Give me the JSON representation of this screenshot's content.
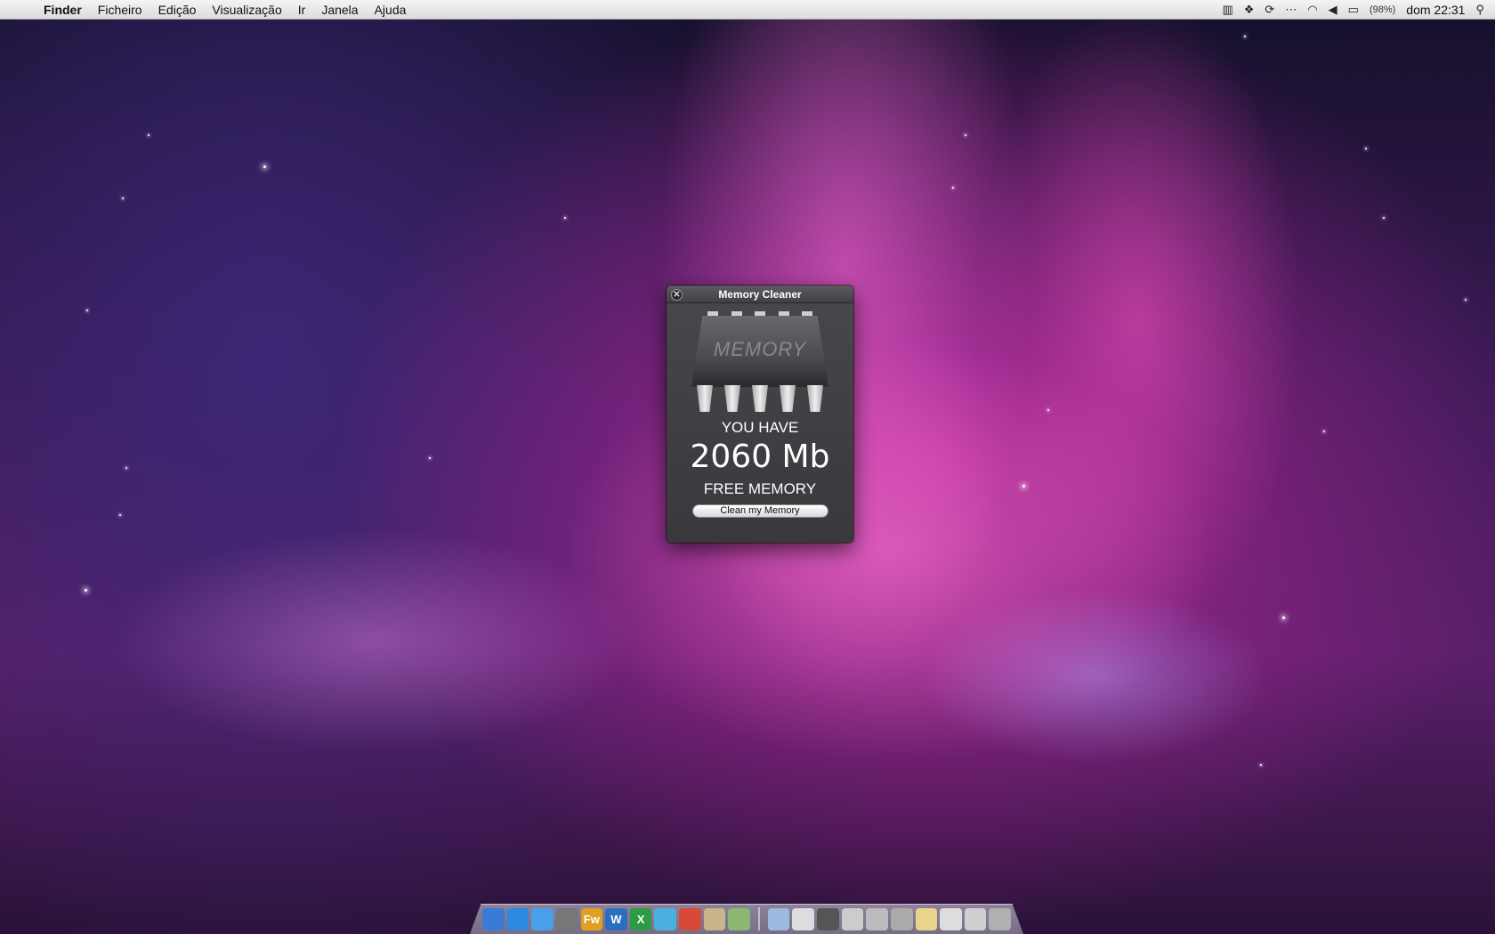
{
  "menubar": {
    "apple_symbol": "",
    "items": [
      "Finder",
      "Ficheiro",
      "Edição",
      "Visualização",
      "Ir",
      "Janela",
      "Ajuda"
    ],
    "battery": "(98%)",
    "clock": "dom 22:31",
    "status_icons": [
      "stats-icon",
      "dropbox-icon",
      "sync-icon",
      "bluetooth-icon",
      "wifi-icon",
      "volume-icon",
      "battery-icon",
      "spotlight-icon"
    ]
  },
  "widget": {
    "title": "Memory Cleaner",
    "chip_label": "MEMORY",
    "you_have": "YOU HAVE",
    "amount": "2060 Mb",
    "free_memory": "FREE MEMORY",
    "clean_button": "Clean my Memory"
  },
  "dock": {
    "apps": [
      {
        "name": "finder-icon",
        "color": "#3a7bd5"
      },
      {
        "name": "app-store-icon",
        "color": "#2c8ae0"
      },
      {
        "name": "itunes-icon",
        "color": "#4aa0e8"
      },
      {
        "name": "preview-icon",
        "color": "#777777"
      },
      {
        "name": "fireworks-icon",
        "color": "#e0a020",
        "label": "Fw"
      },
      {
        "name": "word-icon",
        "color": "#2a6fbf",
        "label": "W"
      },
      {
        "name": "excel-icon",
        "color": "#2d9a45",
        "label": "X"
      },
      {
        "name": "messenger-icon",
        "color": "#4ab0e0"
      },
      {
        "name": "chrome-icon",
        "color": "#d84a38"
      },
      {
        "name": "archive-icon",
        "color": "#c9b58a"
      },
      {
        "name": "spreadsheet-icon",
        "color": "#8bb870"
      }
    ],
    "stacks": [
      {
        "name": "folder-icon",
        "color": "#9bbbe0"
      },
      {
        "name": "stack-icon-1",
        "color": "#dddddd"
      },
      {
        "name": "stack-icon-2",
        "color": "#555555"
      },
      {
        "name": "stack-icon-3",
        "color": "#cccccc"
      },
      {
        "name": "stack-icon-4",
        "color": "#bbbbbb"
      },
      {
        "name": "stack-icon-5",
        "color": "#aaaaaa"
      },
      {
        "name": "stack-icon-6",
        "color": "#e8d48a"
      },
      {
        "name": "stack-icon-7",
        "color": "#dddddd"
      },
      {
        "name": "stack-icon-8",
        "color": "#cfcfcf"
      },
      {
        "name": "trash-icon",
        "color": "#b0b0b0"
      }
    ]
  }
}
